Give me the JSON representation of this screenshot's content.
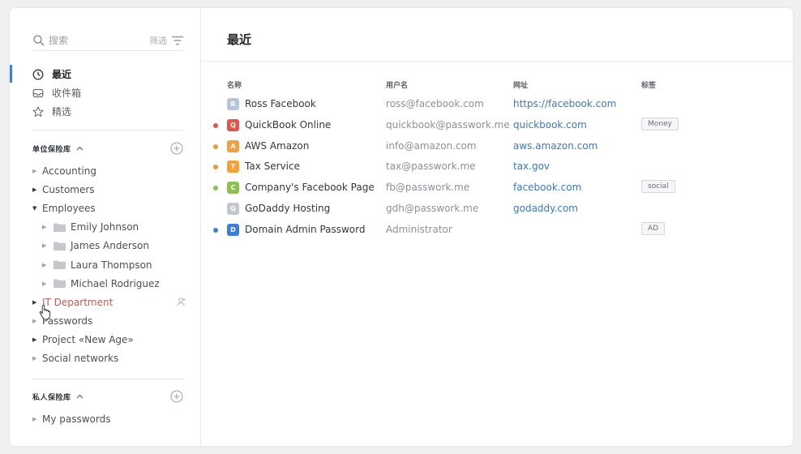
{
  "search": {
    "placeholder": "搜索",
    "filter_label": "筛选"
  },
  "nav": [
    {
      "label": "最近",
      "icon": "clock-icon",
      "active": true
    },
    {
      "label": "收件箱",
      "icon": "inbox-icon",
      "active": false
    },
    {
      "label": "精选",
      "icon": "star-icon",
      "active": false
    }
  ],
  "org_vaults": {
    "title": "单位保险库",
    "items": [
      {
        "label": "Accounting"
      },
      {
        "label": "Customers"
      },
      {
        "label": "Employees"
      },
      {
        "label": "Emily Johnson"
      },
      {
        "label": "James Anderson"
      },
      {
        "label": "Laura Thompson"
      },
      {
        "label": "Michael Rodriguez"
      },
      {
        "label": "IT Department"
      },
      {
        "label": "Passwords"
      },
      {
        "label": "Project «New Age»"
      },
      {
        "label": "Social networks"
      }
    ]
  },
  "private_vaults": {
    "title": "私人保险库",
    "items": [
      {
        "label": "My passwords"
      }
    ]
  },
  "main": {
    "title": "最近",
    "columns": {
      "name": "名称",
      "user": "用户名",
      "url": "网址",
      "tag": "标签"
    },
    "rows": [
      {
        "letter": "R",
        "avatar_color": "#b8c4da",
        "dot_color": "",
        "name": "Ross Facebook",
        "user": "ross@facebook.com",
        "url": "https://facebook.com",
        "tag": ""
      },
      {
        "letter": "Q",
        "avatar_color": "#e2574c",
        "dot_color": "#e2574c",
        "name": "QuickBook Online",
        "user": "quickbook@passwork.me",
        "url": "quickbook.com",
        "tag": "Money"
      },
      {
        "letter": "A",
        "avatar_color": "#f0a040",
        "dot_color": "#f0963a",
        "name": "AWS Amazon",
        "user": "info@amazon.com",
        "url": "aws.amazon.com",
        "tag": ""
      },
      {
        "letter": "T",
        "avatar_color": "#f4a13a",
        "dot_color": "#f0963a",
        "name": "Tax Service",
        "user": "tax@passwork.me",
        "url": "tax.gov",
        "tag": ""
      },
      {
        "letter": "C",
        "avatar_color": "#8cc152",
        "dot_color": "#8cc152",
        "name": "Company's Facebook Page",
        "user": "fb@passwork.me",
        "url": "facebook.com",
        "tag": "social"
      },
      {
        "letter": "G",
        "avatar_color": "#c3c6cb",
        "dot_color": "",
        "name": "GoDaddy Hosting",
        "user": "gdh@passwork.me",
        "url": "godaddy.com",
        "tag": ""
      },
      {
        "letter": "D",
        "avatar_color": "#3b7fd8",
        "dot_color": "#3b7fd8",
        "name": "Domain Admin Password",
        "user": "Administrator",
        "url": "",
        "tag": "AD"
      }
    ]
  }
}
